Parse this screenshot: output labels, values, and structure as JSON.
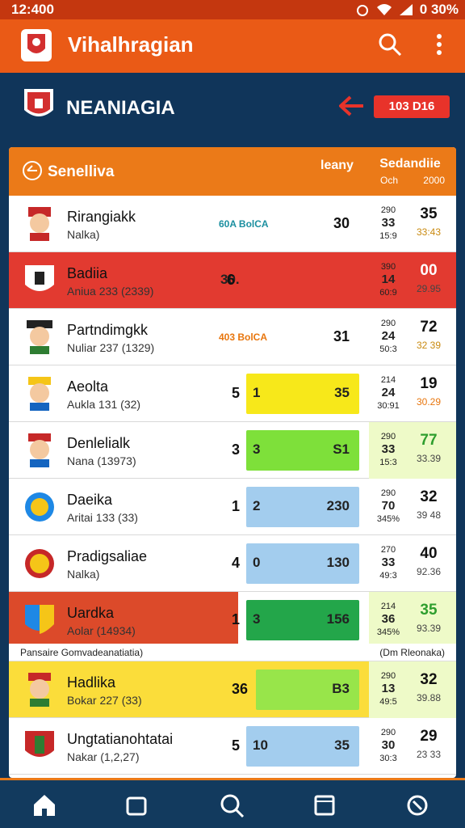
{
  "status_bar": {
    "time": "12:400",
    "battery": "0 30%"
  },
  "app_bar": {
    "title": "Vihalhragian",
    "logo_icon": "club-logo-icon",
    "search_icon": "search-icon",
    "more_icon": "more-vert-icon"
  },
  "team_header": {
    "name": "NEANIAGIA",
    "badge": "103 D16",
    "arrow_icon": "arrow-left-icon"
  },
  "card": {
    "title": "Senelliva",
    "col1": "leany",
    "col2": "Sedandiie",
    "col2_sub_left": "Och",
    "col2_sub_right": "2000",
    "rows": [
      {
        "name": "Rirangiakk",
        "sub": "Nalka)",
        "tag": "60A BolCA",
        "num": "30",
        "stk": [
          "290",
          "33",
          "15:9"
        ],
        "fin_big": "35",
        "fin_small": "33:43"
      },
      {
        "name": "Badiia",
        "sub": "Aniua 233 (2339)",
        "tag": "",
        "num": "6",
        "barL": "30.",
        "stk": [
          "390",
          "14",
          "60:9"
        ],
        "fin_big": "00",
        "fin_small": "29.95"
      },
      {
        "name": "Partndimgkk",
        "sub": "Nuliar 237 (1329)",
        "tag": "403 BolCA",
        "num": "31",
        "stk": [
          "290",
          "24",
          "50:3"
        ],
        "fin_big": "72",
        "fin_small": "32 39"
      },
      {
        "name": "Aeolta",
        "sub": "Aukla 131 (32)",
        "num_left": "5",
        "barL": "1",
        "num": "35",
        "stk": [
          "214",
          "24",
          "30:91"
        ],
        "fin_big": "19",
        "fin_small": "30.29"
      },
      {
        "name": "Denlelialk",
        "sub": "Nana (13973)",
        "num_left": "3",
        "barL": "3",
        "num": "S1",
        "stk": [
          "290",
          "33",
          "15:3"
        ],
        "fin_big": "77",
        "fin_small": "33.39"
      },
      {
        "name": "Daeika",
        "sub": "Aritai 133 (33)",
        "num_left": "1",
        "barL": "2",
        "num": "230",
        "stk": [
          "290",
          "70",
          "345%"
        ],
        "fin_big": "32",
        "fin_small": "39 48"
      },
      {
        "name": "Pradigsaliae",
        "sub": "Nalka)",
        "num_left": "4",
        "barL": "0",
        "num": "130",
        "stk": [
          "270",
          "33",
          "49:3"
        ],
        "fin_big": "40",
        "fin_small": "92.36"
      },
      {
        "name": "Uardka",
        "sub": "Aolar (14934)",
        "num_left": "1",
        "barL": "3",
        "num": "156",
        "stk": [
          "214",
          "36",
          "345%"
        ],
        "fin_big": "35",
        "fin_small": "93.39"
      }
    ],
    "subhead_left": "Pansaire Gomvadeanatiatia)",
    "subhead_right": "(Dm Rleonaka)",
    "rows2": [
      {
        "name": "Hadlika",
        "sub": "Bokar 227 (33)",
        "num_left": "36",
        "num": "B3",
        "stk": [
          "290",
          "13",
          "49:5"
        ],
        "fin_big": "32",
        "fin_small": "39.88"
      },
      {
        "name": "Ungtatianohtatai",
        "sub": "Nakar (1,2,27)",
        "num_left": "5",
        "barL": "10",
        "num": "35",
        "stk": [
          "290",
          "30",
          "30:3"
        ],
        "fin_big": "29",
        "fin_small": "23 33"
      }
    ]
  },
  "bottom_nav": [
    "home-icon",
    "window-icon",
    "search-icon",
    "tabs-icon",
    "settings-icon"
  ]
}
